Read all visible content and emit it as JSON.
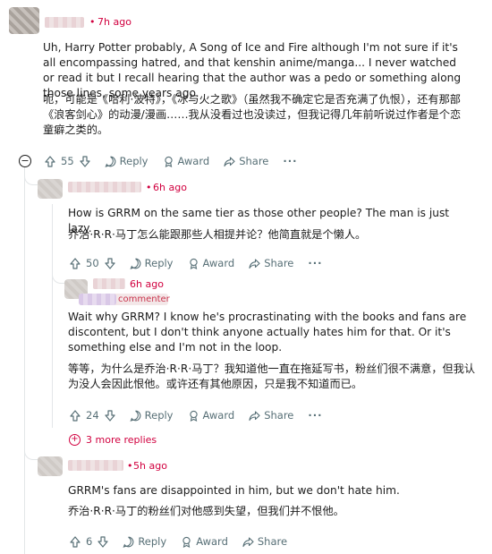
{
  "comments": [
    {
      "time": "7h ago",
      "text_en": "Uh, Harry Potter probably, A Song of Ice and Fire although I'm not sure if it's all encompassing hatred, and that kenshin anime/manga... I never watched or read it but I recall hearing that the author was a pedo or something along those lines, some years ago.",
      "text_zh": "呃，可能是《哈利·波特》，《冰与火之歌》（虽然我不确定它是否充满了仇恨），还有那部《浪客剑心》的动漫/漫画……我从没看过也没读过，但我记得几年前听说过作者是个恋童癖之类的。",
      "votes": "55"
    },
    {
      "time": "6h ago",
      "text_en": "How is GRRM on the same tier as those other people? The man is just lazy.",
      "text_zh": "乔治·R·R·马丁怎么能跟那些人相提并论？他简直就是个懒人。",
      "votes": "50"
    },
    {
      "time": "6h ago",
      "badge": "commenter",
      "text_en": "Wait why GRRM? I know he's procrastinating with the books and fans are discontent, but I don't think anyone actually hates him for that. Or it's something else and I'm not in the loop.",
      "text_zh": "等等，为什么是乔治·R·R·马丁？我知道他一直在拖延写书，粉丝们很不满意，但我认为没人会因此恨他。或许还有其他原因，只是我不知道而已。",
      "votes": "24"
    },
    {
      "time": "5h ago",
      "text_en": "GRRM's fans are disappointed in him, but we don't hate him.",
      "text_zh": "乔治·R·R·马丁的粉丝们对他感到失望，但我们并不恨他。",
      "votes": "6"
    }
  ],
  "labels": {
    "separator": "•",
    "reply": "Reply",
    "award": "Award",
    "share": "Share",
    "more": "···",
    "more_replies": "3 more replies",
    "collapse": "−"
  }
}
